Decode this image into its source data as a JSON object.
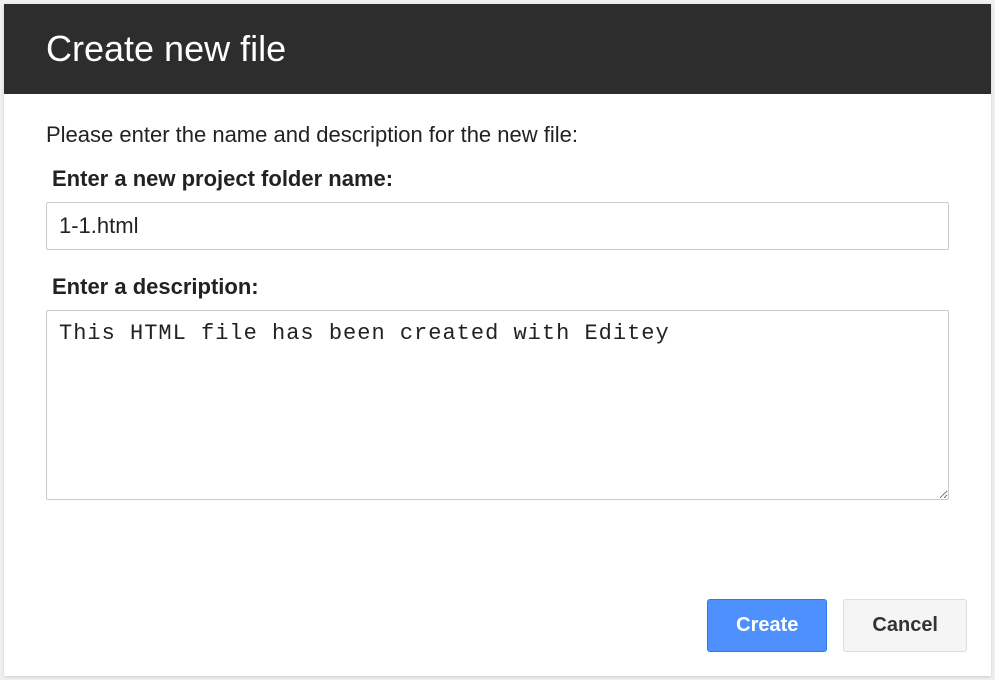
{
  "dialog": {
    "title": "Create new file",
    "intro": "Please enter the name and description for the new file:",
    "folder_label": "Enter a new project folder name:",
    "folder_value": "1-1.html",
    "description_label": "Enter a description:",
    "description_value": "This HTML file has been created with Editey",
    "create_label": "Create",
    "cancel_label": "Cancel"
  }
}
